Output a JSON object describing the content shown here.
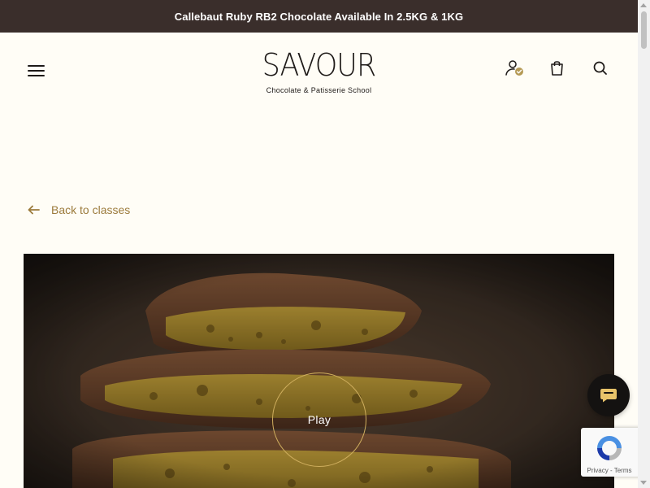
{
  "announcement": {
    "text": "Callebaut Ruby RB2 Chocolate Available In 2.5KG & 1KG"
  },
  "header": {
    "menu_icon": "hamburger-menu-icon",
    "logo": {
      "wordmark": "SAVOUR",
      "tagline": "Chocolate & Patisserie School"
    },
    "icons": [
      "account-icon",
      "cart-icon",
      "search-icon"
    ]
  },
  "back_link": {
    "label": "Back to classes",
    "icon": "arrow-left-icon"
  },
  "hero": {
    "image": "honeycomb-chocolate-stack",
    "play_label": "Play"
  },
  "chat": {
    "icon": "chat-bubble-icon"
  },
  "recaptcha": {
    "privacy": "Privacy",
    "separator": " - ",
    "terms": "Terms"
  },
  "colors": {
    "announcement_bg": "#3a2e2b",
    "page_bg": "#fffdf6",
    "accent_gold": "#9c7b3c",
    "text_dark": "#1e1a18"
  }
}
